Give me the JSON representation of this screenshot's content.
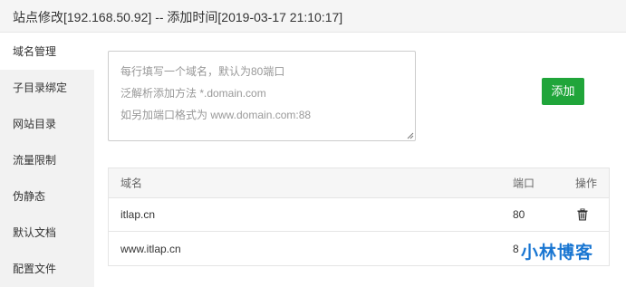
{
  "window": {
    "title": "站点修改[192.168.50.92] -- 添加时间[2019-03-17 21:10:17]"
  },
  "sidebar": {
    "items": [
      {
        "label": "域名管理",
        "active": true
      },
      {
        "label": "子目录绑定"
      },
      {
        "label": "网站目录"
      },
      {
        "label": "流量限制"
      },
      {
        "label": "伪静态"
      },
      {
        "label": "默认文档"
      },
      {
        "label": "配置文件"
      }
    ]
  },
  "form": {
    "textarea_value": "",
    "placeholder_lines": [
      "每行填写一个域名，默认为80端口",
      "泛解析添加方法 *.domain.com",
      "如另加端口格式为 www.domain.com:88"
    ],
    "add_button": "添加"
  },
  "table": {
    "headers": {
      "domain": "域名",
      "port": "端口",
      "op": "操作"
    },
    "rows": [
      {
        "domain": "itlap.cn",
        "port": "80"
      },
      {
        "domain": "www.itlap.cn",
        "port": "8"
      }
    ]
  },
  "watermark": "小林博客",
  "colors": {
    "accent": "#20a53a",
    "watermark": "#1976d2"
  }
}
